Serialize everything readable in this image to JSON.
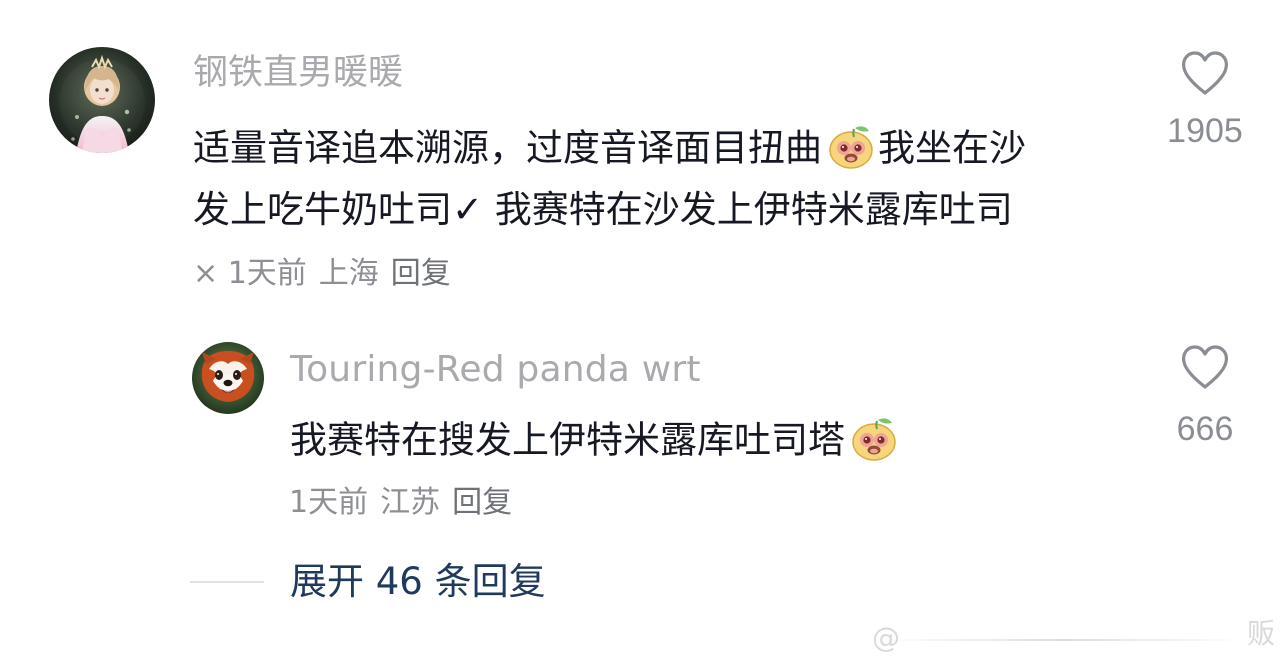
{
  "main_comment": {
    "username": "钢铁直男暖暖",
    "text_line_1_before_emoji": "适量音译追本溯源，过度音译面目扭曲",
    "text_line_1_after_emoji": "我坐在沙",
    "text_line_2": "发上吃牛奶吐司✓ 我赛特在沙发上伊特米露库吐司",
    "meta_prefix": "×",
    "meta_time": "1天前",
    "meta_location": "上海",
    "meta_reply": "回复",
    "like_count": "1905"
  },
  "reply_comment": {
    "username": "Touring-Red panda wrt",
    "text_before_emoji": "我赛特在搜发上伊特米露库吐司塔",
    "meta_time": "1天前",
    "meta_location": "江苏",
    "meta_reply": "回复",
    "like_count": "666"
  },
  "expand": {
    "label": "展开 46 条回复"
  },
  "watermark": {
    "visible_text": "贩"
  },
  "colors": {
    "background": "#ffffff",
    "primary_text": "#161823",
    "secondary_text": "#8d8f94",
    "username": "#a9aaae",
    "expand_text": "#1f3a5d"
  },
  "icons": {
    "heart": "heart-outline-icon",
    "emoji": "smiling-emoji-icon"
  }
}
